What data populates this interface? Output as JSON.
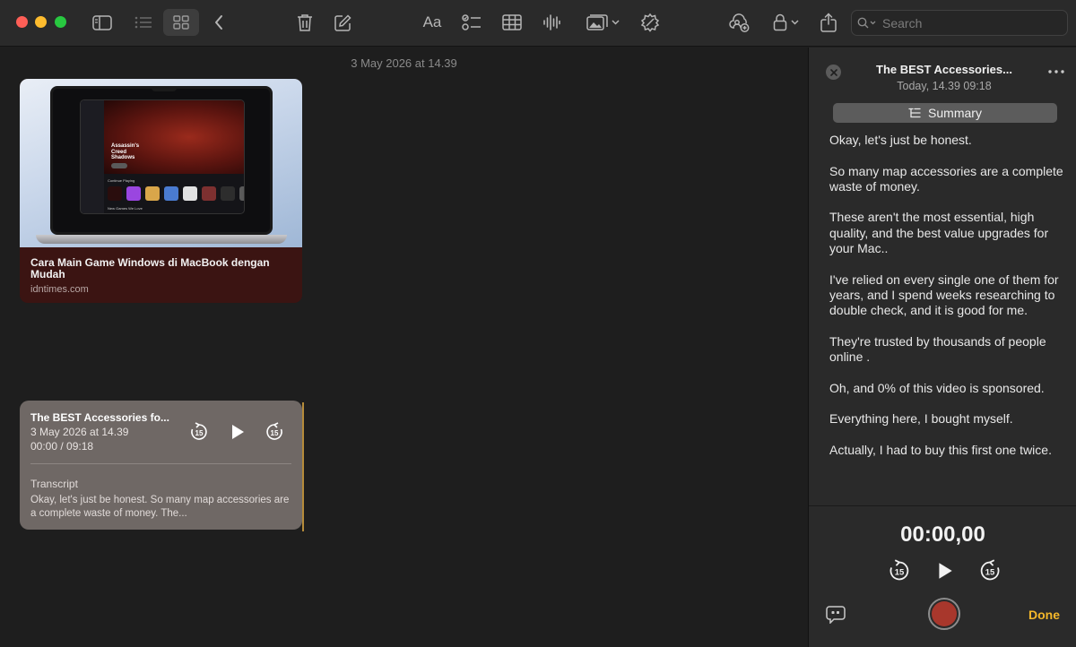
{
  "toolbar": {
    "search_placeholder": "Search",
    "format_label": "Aa",
    "icons": [
      "sidebar-icon",
      "list-view-icon",
      "gallery-view-icon",
      "back-icon",
      "trash-icon",
      "compose-icon",
      "format-icon",
      "checklist-icon",
      "table-icon",
      "audio-icon",
      "media-icon",
      "writing-tools-icon",
      "collaborate-icon",
      "lock-icon",
      "share-icon",
      "search-icon"
    ]
  },
  "main": {
    "date_header": "3 May 2026 at 14.39",
    "link_card": {
      "title": "Cara Main Game Windows di MacBook dengan Mudah",
      "domain": "idntimes.com",
      "thumb_hero_title": "Assassin's Creed Shadows",
      "thumb_row1": "Continue Playing",
      "thumb_row2": "New Games We Love"
    },
    "audio_card": {
      "title": "The BEST Accessories fo...",
      "date": "3 May 2026 at 14.39",
      "time": "00:00 / 09:18",
      "skip_seconds": "15",
      "transcript_label": "Transcript",
      "transcript_preview": "Okay, let's just be honest. So many map accessories are a complete waste of money. The..."
    }
  },
  "panel": {
    "title": "The BEST Accessories...",
    "subtitle": "Today, 14.39   09:18",
    "summary_label": "Summary",
    "transcript": [
      "Okay, let's just be honest.",
      "So many map accessories are a complete waste of money.",
      "These aren't the most essential, high quality, and the best value upgrades for your Mac..",
      "I've relied on every single one of them for years, and I spend weeks researching to double check, and it is good for me.",
      "They're trusted by thousands of people online .",
      "Oh, and 0% of this video is sponsored.",
      "Everything here, I bought myself.",
      "Actually, I had to buy this first one twice."
    ],
    "timer": "00:00,00",
    "skip_seconds": "15",
    "done_label": "Done"
  },
  "colors": {
    "accent_done": "#f5b82a",
    "record": "#a8372c",
    "link_card_bg": "#3b1412",
    "audio_card_bg": "#6f6865"
  }
}
